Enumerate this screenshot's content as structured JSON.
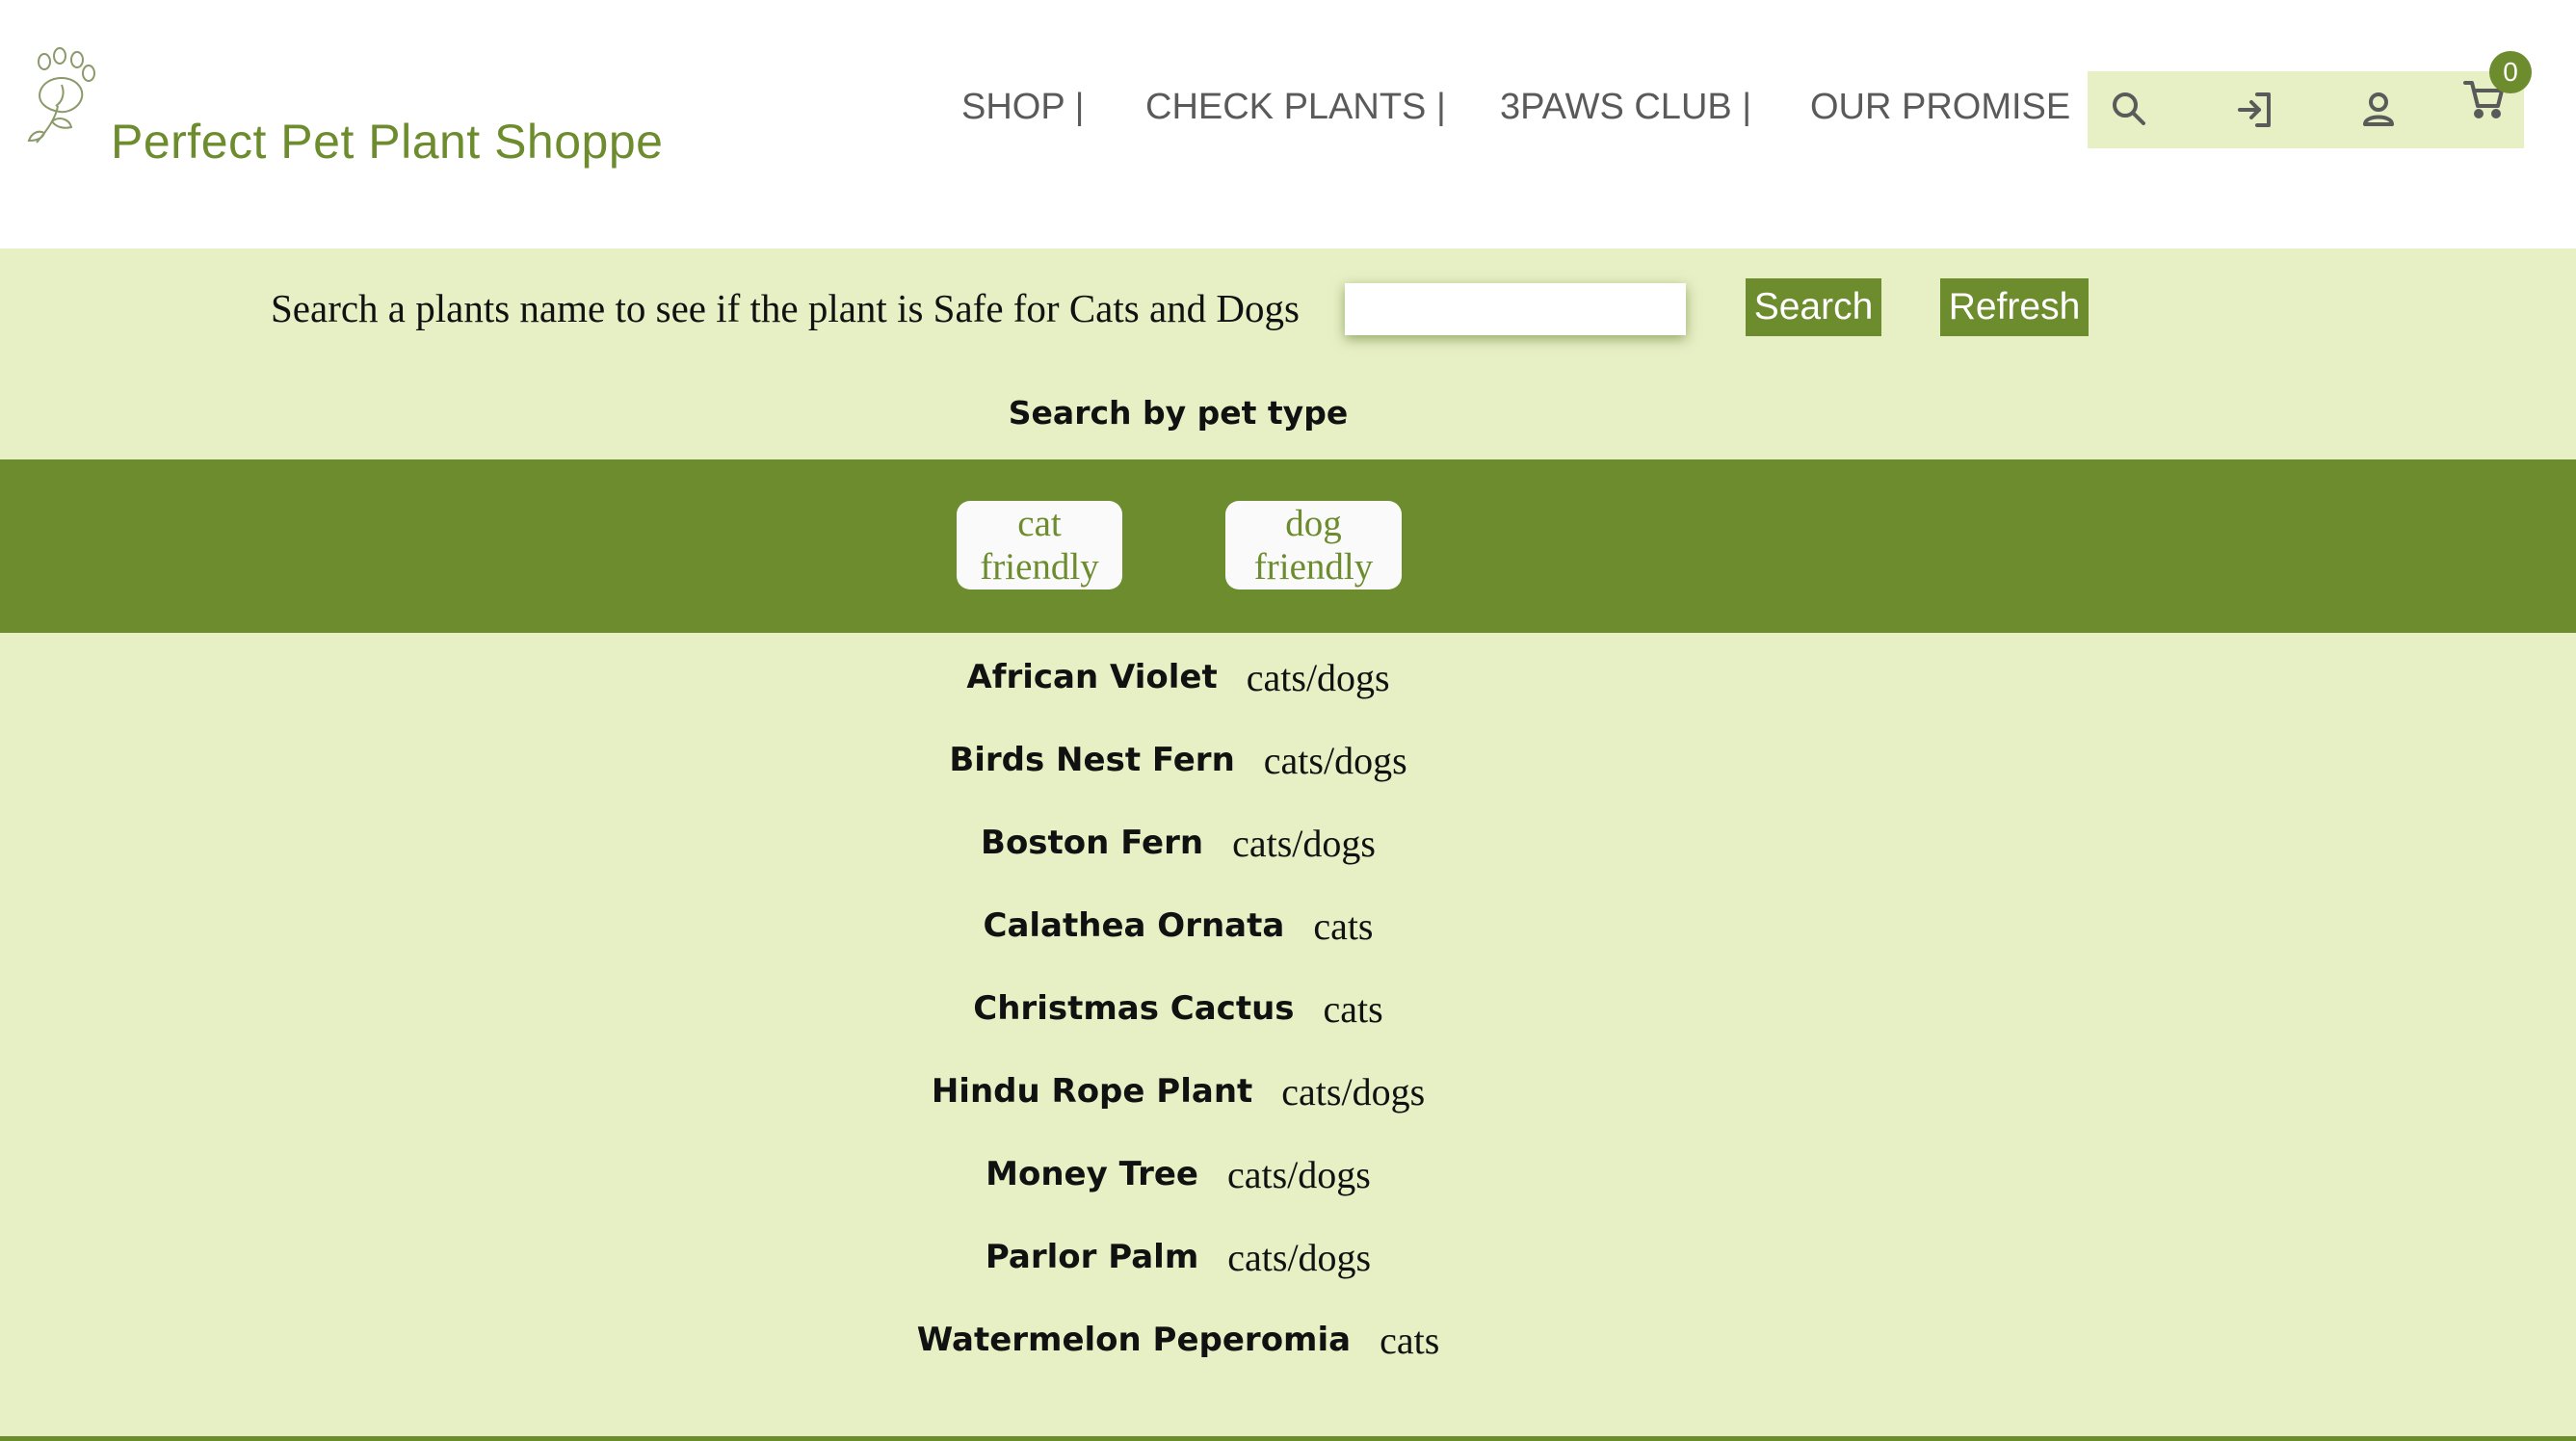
{
  "brand": {
    "name": "Perfect Pet Plant Shoppe",
    "logo_icon": "paw-leaf-icon",
    "accent_color": "#6c8c2e",
    "background_color": "#e7efc5"
  },
  "nav": {
    "shop": "SHOP |",
    "check_plants": "CHECK PLANTS |",
    "club": "3PAWS CLUB |",
    "promise": "OUR PROMISE"
  },
  "header_icons": {
    "search": "search-icon",
    "login": "login-icon",
    "account": "user-icon",
    "cart": "cart-icon",
    "cart_count": "0"
  },
  "search": {
    "label": "Search a plants name to see if the plant is Safe for Cats and Dogs",
    "value": "",
    "search_button": "Search",
    "refresh_button": "Refresh"
  },
  "pet_filter": {
    "label": "Search by pet type",
    "cat_line1": "cat",
    "cat_line2": "friendly",
    "dog_line1": "dog",
    "dog_line2": "friendly"
  },
  "plants": [
    {
      "name": "African Violet",
      "pets": "cats/dogs"
    },
    {
      "name": "Birds Nest Fern",
      "pets": "cats/dogs"
    },
    {
      "name": "Boston Fern",
      "pets": "cats/dogs"
    },
    {
      "name": "Calathea Ornata",
      "pets": "cats"
    },
    {
      "name": "Christmas Cactus",
      "pets": "cats"
    },
    {
      "name": "Hindu Rope Plant",
      "pets": "cats/dogs"
    },
    {
      "name": "Money Tree",
      "pets": "cats/dogs"
    },
    {
      "name": "Parlor Palm",
      "pets": "cats/dogs"
    },
    {
      "name": "Watermelon Peperomia",
      "pets": "cats"
    }
  ]
}
